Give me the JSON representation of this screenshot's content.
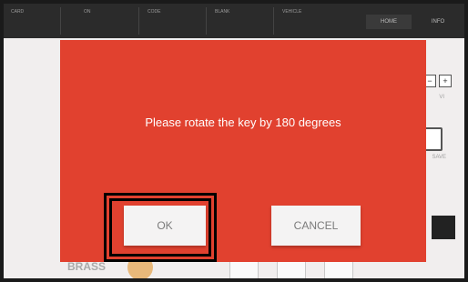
{
  "topbar": {
    "cells": [
      "CARD",
      "ON",
      "CODE",
      "BLANK",
      "VEHICLE"
    ],
    "home_label": "HOME",
    "info_label": "INFO"
  },
  "side": {
    "zoom_minus": "−",
    "zoom_plus": "+",
    "zoom_label": "VI",
    "save_label": "SAVE"
  },
  "bottom": {
    "material": "BRASS"
  },
  "dialog": {
    "message": "Please rotate the key by 180 degrees",
    "ok_label": "OK",
    "cancel_label": "CANCEL"
  },
  "colors": {
    "dialog_bg": "#e1412f",
    "highlight": "#000000"
  }
}
